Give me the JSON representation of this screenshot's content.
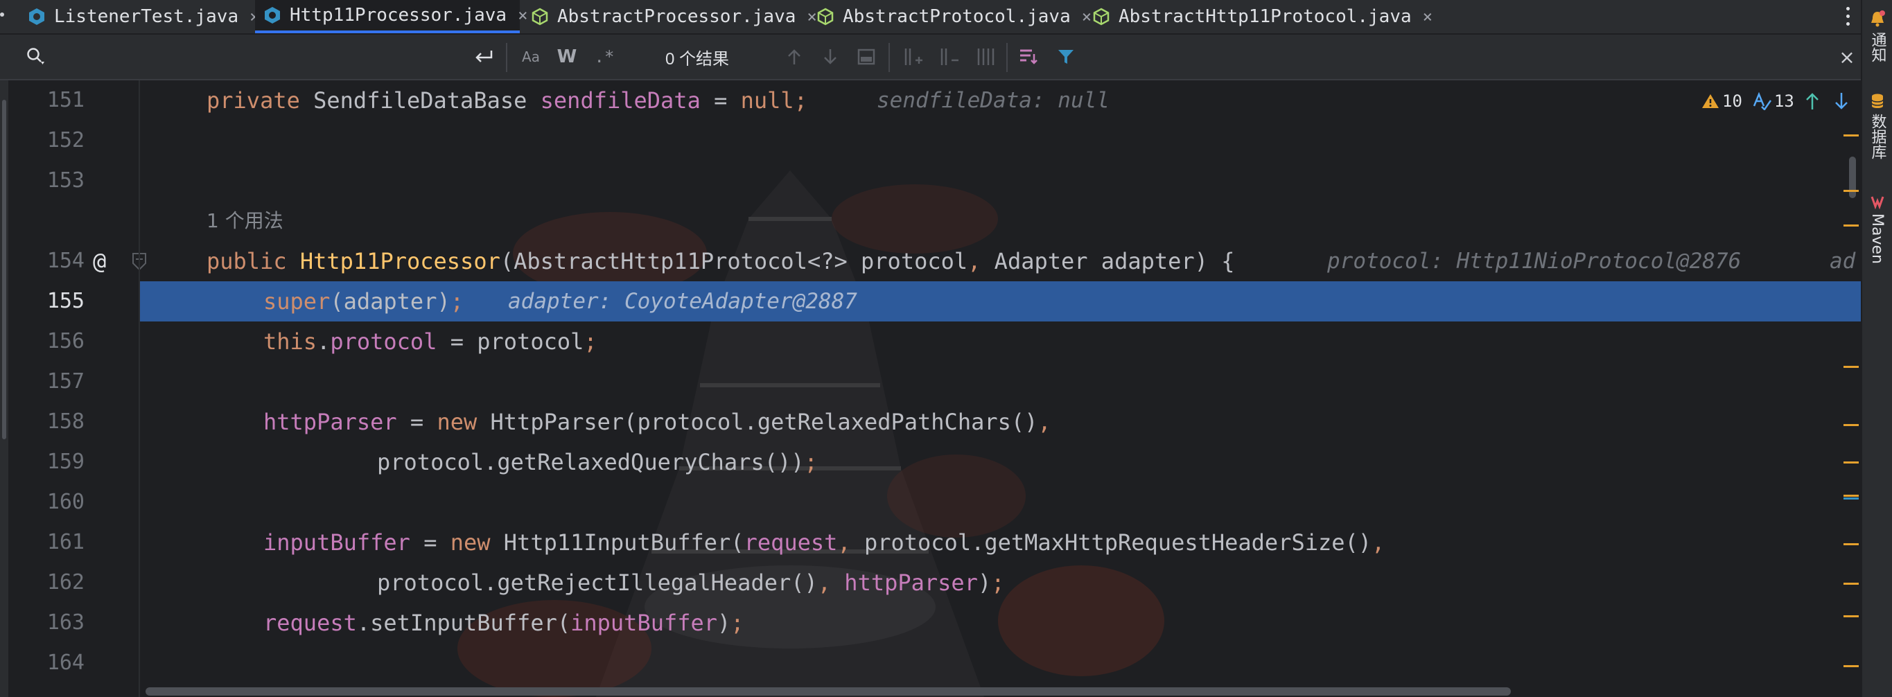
{
  "tabs": [
    {
      "label": "ListenerTest.java",
      "icon": "java-class-icon",
      "active": false
    },
    {
      "label": "Http11Processor.java",
      "icon": "java-class-icon",
      "active": true
    },
    {
      "label": "AbstractProcessor.java",
      "icon": "abstract-class-icon",
      "active": false
    },
    {
      "label": "AbstractProtocol.java",
      "icon": "abstract-class-icon",
      "active": false
    },
    {
      "label": "AbstractHttp11Protocol.java",
      "icon": "abstract-class-icon",
      "active": false
    }
  ],
  "tab_close_glyph": "×",
  "search": {
    "value": "",
    "results": "0 个结果",
    "match_case": "Aa",
    "words": "W",
    "regex": ".*"
  },
  "right_strip": {
    "notifications": "通知",
    "database": "数据库",
    "maven": "Maven"
  },
  "inspections": {
    "warnings": "10",
    "typos": "13"
  },
  "editor": {
    "line_numbers": [
      "151",
      "152",
      "153",
      "154",
      "155",
      "156",
      "157",
      "158",
      "159",
      "160",
      "161",
      "162",
      "163",
      "164"
    ],
    "current_line": "155",
    "usages": "1 个用法",
    "gutter_annotation": "@",
    "lines": {
      "l151": {
        "kw": "private",
        "type": " SendfileDataBase ",
        "field": "sendfileData",
        "rest": " = ",
        "kw2": "null",
        "semi": ";",
        "hint": "sendfileData: null"
      },
      "l154": {
        "kw": "public",
        "fn": "Http11Processor",
        "params": "(AbstractHttp11Protocol<?> protocol",
        "comma": ",",
        "params2": " Adapter adapter) {",
        "hint": "protocol: Http11NioProtocol@2876",
        "hint2": "ad"
      },
      "l155": {
        "kw": "super",
        "rest": "(adapter)",
        "semi": ";",
        "hint": "adapter: CoyoteAdapter@2887"
      },
      "l156": {
        "kw": "this",
        "dot": ".",
        "field": "protocol",
        "rest": " = protocol",
        "semi": ";"
      },
      "l158": {
        "field": "httpParser",
        "eq": " = ",
        "kw": "new",
        "rest": " HttpParser(protocol.getRelaxedPathChars()",
        "comma": ","
      },
      "l159": {
        "rest": "protocol.getRelaxedQueryChars())",
        "semi": ";"
      },
      "l161": {
        "field": "inputBuffer",
        "eq": " = ",
        "kw": "new",
        "rest": " Http11InputBuffer(",
        "field2": "request",
        "comma": ",",
        "rest2": " protocol.getMaxHttpRequestHeaderSize()",
        "comma2": ","
      },
      "l162": {
        "rest": "protocol.getRejectIllegalHeader()",
        "comma": ",",
        "field": " httpParser",
        "rest2": ")",
        "semi": ";"
      },
      "l163": {
        "field": "request",
        "rest": ".setInputBuffer(",
        "field2": "inputBuffer",
        "rest2": ")",
        "semi": ";"
      }
    }
  },
  "colors": {
    "keyword": "#cf8e6d",
    "field": "#c77dbb",
    "method": "#ffc66d",
    "execution_line": "#2d5a9b",
    "tab_active_underline": "#3574f0",
    "marker_warning": "#e5a12e"
  }
}
